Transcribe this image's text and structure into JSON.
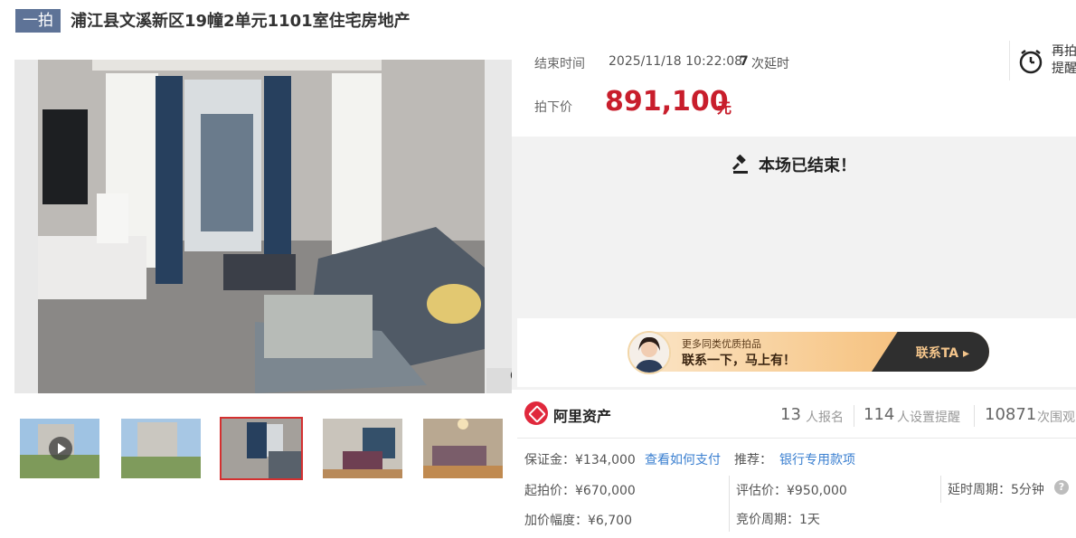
{
  "header": {
    "badge": "一拍",
    "title": "浦江县文溪新区19幢2单元1101室住宅房地产"
  },
  "auction": {
    "end_label": "结束时间",
    "end_time": "2025/11/18 10:22:08",
    "delay_count": "7",
    "delay_suffix": "次延时",
    "final_label": "拍下价",
    "final_price": "891,100",
    "price_unit": "元",
    "reminder_label": "再拍提醒",
    "ended_text": "本场已结束！"
  },
  "promo": {
    "line1": "更多同类优质拍品",
    "line2": "联系一下，马上有！",
    "cta": "联系TA ▸"
  },
  "org": {
    "name": "阿里资产"
  },
  "stats": {
    "signups": "13",
    "signups_label": "人报名",
    "reminders": "114",
    "reminders_label": "人设置提醒",
    "views": "10871",
    "views_label": "次围观"
  },
  "details": {
    "deposit": "保证金：¥134,000",
    "pay_link": "查看如何支付",
    "recommend": "推荐：",
    "bank_link": "银行专用款项",
    "start_price": "起拍价：¥670,000",
    "appraisal": "评估价：¥950,000",
    "delay_period": "延时周期：5分钟",
    "increment": "加价幅度：¥6,700",
    "bid_period": "竞价周期：1天"
  },
  "colors": {
    "accent": "#c81e2c",
    "badge": "#5e7397",
    "link": "#3a7fd0"
  },
  "icons": [
    "zoom-icon",
    "alarm-clock-icon",
    "gavel-icon",
    "play-icon",
    "help-icon"
  ]
}
